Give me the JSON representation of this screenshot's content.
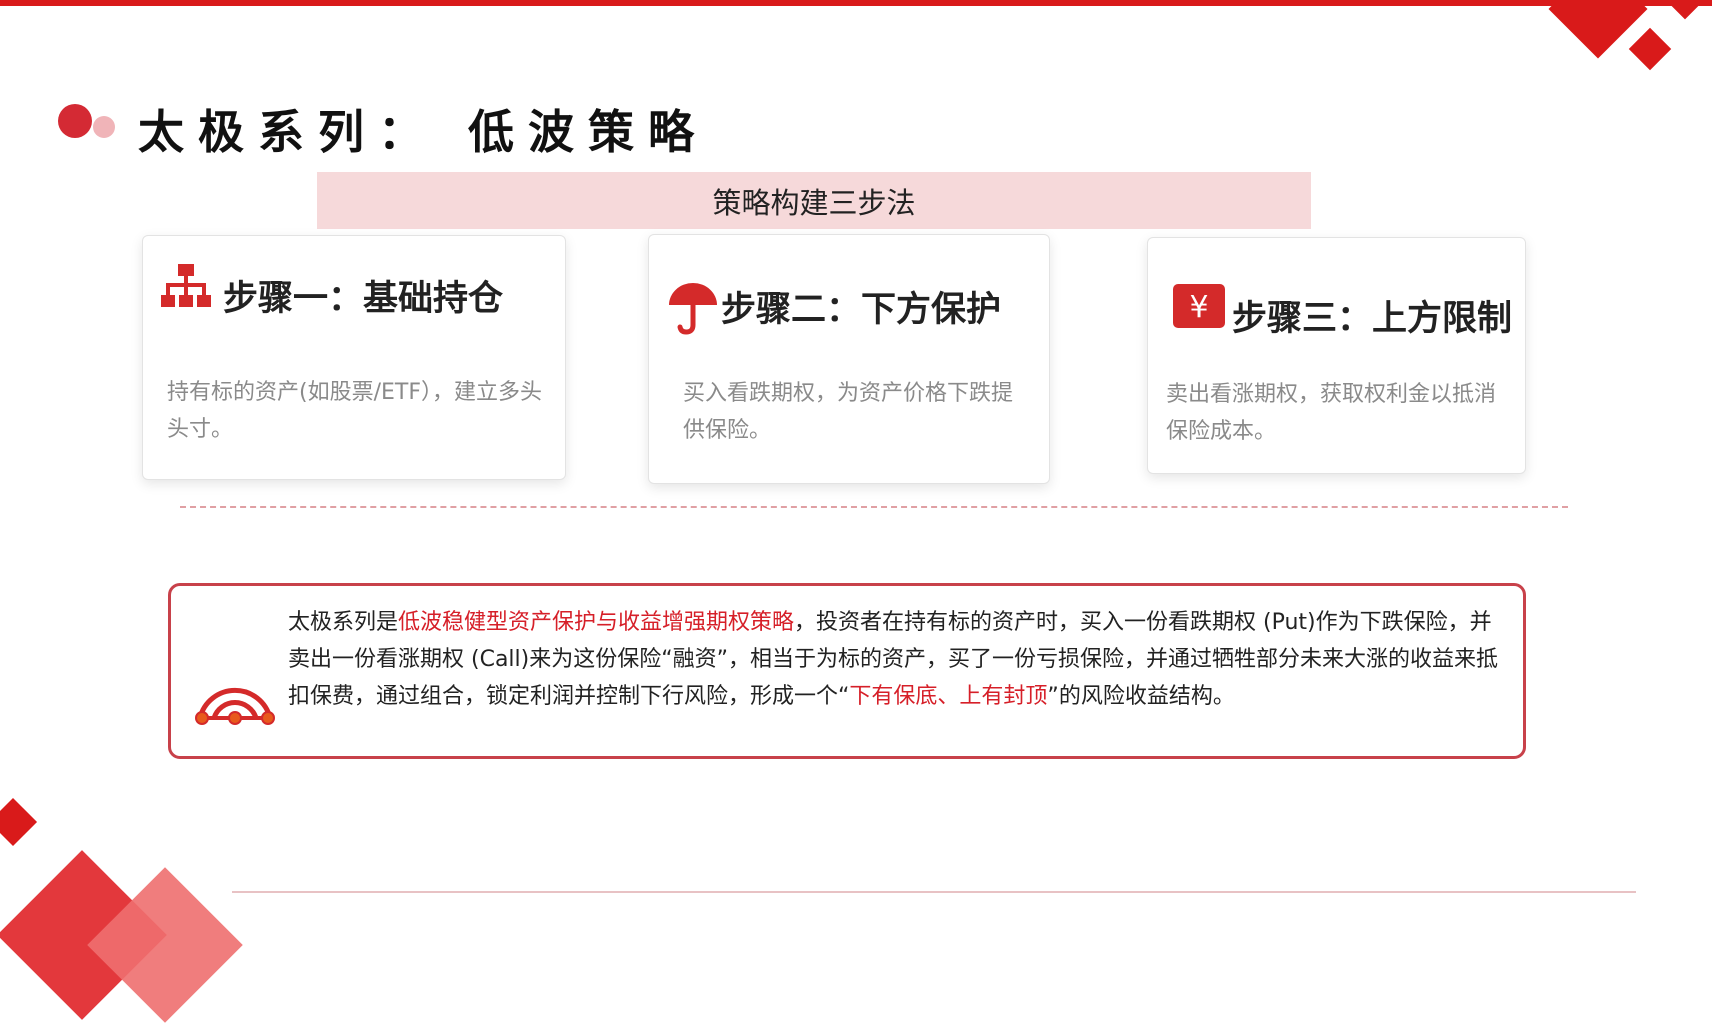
{
  "title": "太极系列： 低波策略",
  "banner": "策略构建三步法",
  "steps": [
    {
      "icon": "hierarchy-icon",
      "title": "步骤一：基础持仓",
      "desc": "持有标的资产(如股票/ETF），建立多头头寸。"
    },
    {
      "icon": "umbrella-icon",
      "title": "步骤二：下方保护",
      "desc": "买入看跌期权，为资产价格下跌提供保险。"
    },
    {
      "icon": "yen-icon",
      "title": "步骤三：上方限制",
      "desc": "卖出看涨期权，获取权利金以抵消保险成本。"
    }
  ],
  "summary": {
    "icon": "bridge-network-icon",
    "p1": "太极系列是",
    "h1": "低波稳健型资产保护与收益增强期权策略",
    "p2": "，投资者在持有标的资产时，买入一份看跌期权 (Put)作为下跌保险，并卖出一份看涨期权 (Call)来为这份保险“融资”，相当于为标的资产，买了一份亏损保险，并通过牺牲部分未来大涨的收益来抵扣保费，通过组合，锁定利润并控制下行风险，形成一个“",
    "h2": "下有保底、上有封顶",
    "p3": "”的风险收益结构。"
  },
  "colors": {
    "accent": "#d91a1a",
    "banner_bg": "#f6d9da",
    "highlight": "#d61f28"
  }
}
